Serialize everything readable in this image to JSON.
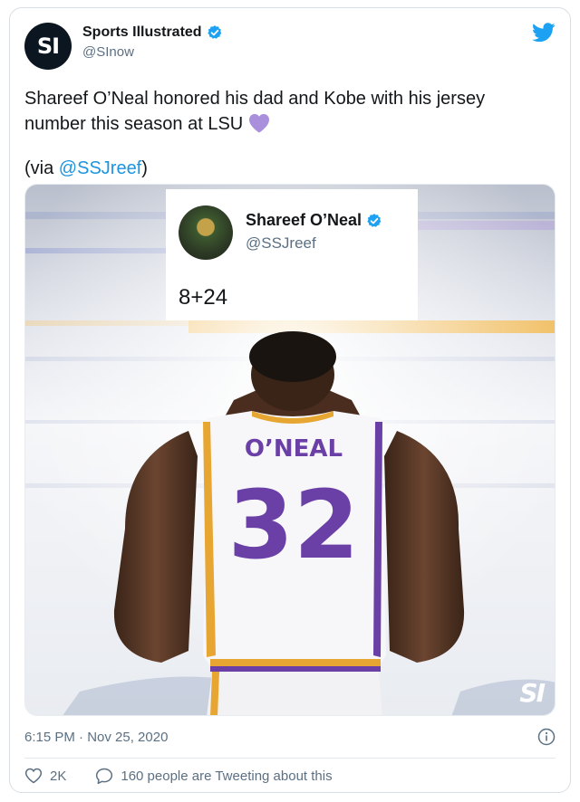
{
  "author": {
    "avatar_text": "SI",
    "name": "Sports Illustrated",
    "handle": "@SInow"
  },
  "tweet": {
    "text": "Shareef O’Neal honored his dad and Kobe with his jersey number this season at LSU",
    "via_prefix": "(via ",
    "via_link": "@SSJreef",
    "via_suffix": ")"
  },
  "media": {
    "embedded_tweet": {
      "name": "Shareef O’Neal",
      "handle": "@SSJreef",
      "text": "8+24"
    },
    "watermark": "SI",
    "jersey": {
      "name": "O’NEAL",
      "number": "32"
    }
  },
  "timestamp": "6:15 PM · Nov 25, 2020",
  "actions": {
    "likes": "2K",
    "conversation": "160 people are Tweeting about this"
  },
  "colors": {
    "link": "#1b95e0",
    "verified": "#1da1f2",
    "heart_emoji": "#a98fdc",
    "jersey_purple": "#6a3fa6",
    "jersey_gold": "#e7a631"
  },
  "icons": {
    "brand": "twitter-bird-icon",
    "verified": "verified-badge-icon",
    "info": "info-icon",
    "like": "heart-outline-icon",
    "reply": "speech-bubble-icon"
  }
}
